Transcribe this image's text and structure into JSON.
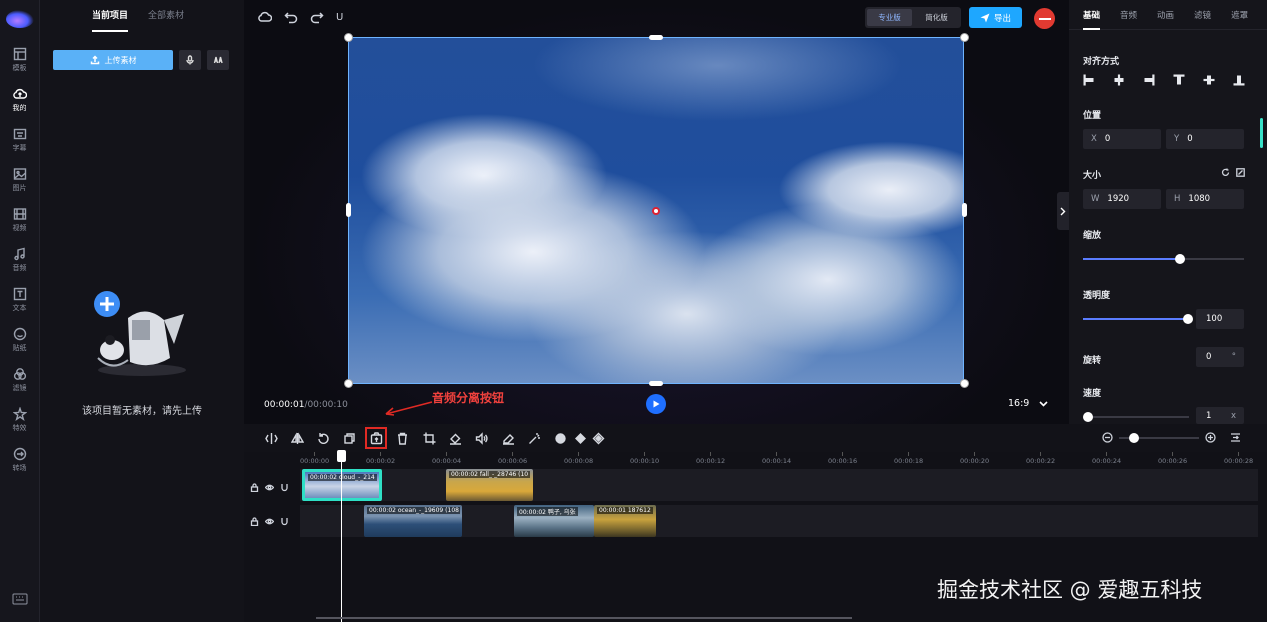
{
  "rail": {
    "items": [
      {
        "label": "模板",
        "icon": "template-icon"
      },
      {
        "label": "我的",
        "icon": "cloud-upload-icon",
        "active": true
      },
      {
        "label": "字幕",
        "icon": "caption-icon"
      },
      {
        "label": "图片",
        "icon": "image-icon"
      },
      {
        "label": "视频",
        "icon": "video-icon"
      },
      {
        "label": "音频",
        "icon": "music-icon"
      },
      {
        "label": "文本",
        "icon": "text-icon"
      },
      {
        "label": "贴纸",
        "icon": "sticker-icon"
      },
      {
        "label": "滤镜",
        "icon": "filter-icon"
      },
      {
        "label": "特效",
        "icon": "effect-icon"
      },
      {
        "label": "转场",
        "icon": "transition-icon"
      }
    ]
  },
  "media": {
    "tabs": [
      "当前项目",
      "全部素材"
    ],
    "upload_label": "上传素材",
    "empty_text": "该项目暂无素材，请先上传"
  },
  "preview": {
    "mode_pro": "专业版",
    "mode_simple": "简化版",
    "export_label": "导出",
    "underline_label": "U",
    "time_current": "00:00:01",
    "time_total": "/00:00:10",
    "ratio": "16:9",
    "annotation": "音频分离按钮"
  },
  "props": {
    "tabs": [
      "基础",
      "音频",
      "动画",
      "滤镜",
      "遮罩"
    ],
    "align_title": "对齐方式",
    "position_title": "位置",
    "pos_x_key": "X",
    "pos_x": "0",
    "pos_y_key": "Y",
    "pos_y": "0",
    "size_title": "大小",
    "w_key": "W",
    "w": "1920",
    "h_key": "H",
    "h": "1080",
    "scale_title": "缩放",
    "scale_value": 0.6,
    "opacity_title": "透明度",
    "opacity_value": "100",
    "rotate_title": "旋转",
    "rotate_value": "0",
    "rotate_unit": "°",
    "speed_title": "速度",
    "speed_value": "1",
    "speed_unit": "x"
  },
  "timeline": {
    "ticks": [
      "00:00:00",
      "00:00:02",
      "00:00:04",
      "00:00:06",
      "00:00:08",
      "00:00:10",
      "00:00:12",
      "00:00:14",
      "00:00:16",
      "00:00:18",
      "00:00:20",
      "00:00:22",
      "00:00:24",
      "00:00:26",
      "00:00:28"
    ],
    "track1_clips": [
      {
        "label": "00:00:02 cloud_-_214",
        "selected": true
      },
      {
        "label": "00:00:02 fall_-_28746 (10"
      }
    ],
    "track2_clips": [
      {
        "label": "00:00:02 ocean_-_19609 (108"
      },
      {
        "label": "00:00:02 鸭子, 乌张"
      },
      {
        "label": "00:00:01 187612"
      }
    ]
  },
  "watermark": "掘金技术社区 @ 爱趣五科技",
  "colors": {
    "accent": "#1ea7ff",
    "selection": "#6fb4ff",
    "highlight_box": "#e02a24",
    "annotation_text": "#f0413d",
    "clip_selected_border": "#2fe0c6"
  }
}
